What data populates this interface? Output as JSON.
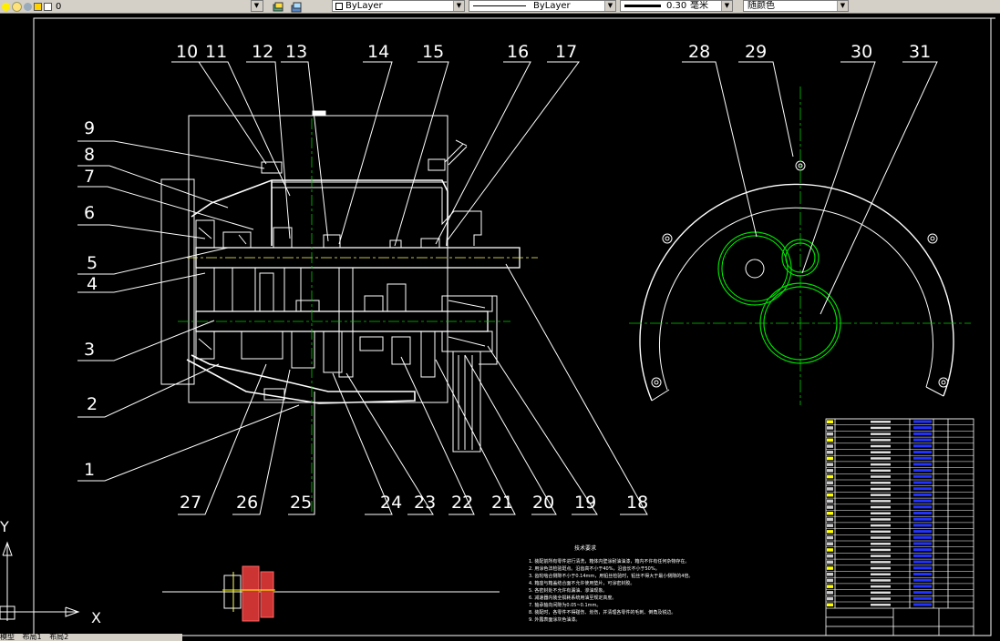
{
  "toolbar": {
    "layer_value": "0",
    "color_combo": "ByLayer",
    "linetype_combo": "ByLayer",
    "lineweight_value": "0.30",
    "lineweight_unit": "毫米",
    "plotstyle_combo": "随颜色"
  },
  "part_numbers": {
    "left": [
      "9",
      "8",
      "7",
      "6",
      "5",
      "4",
      "3",
      "2",
      "1"
    ],
    "top": [
      "10",
      "11",
      "12",
      "13",
      "14",
      "15",
      "16",
      "17"
    ],
    "bottom": [
      "27",
      "26",
      "25",
      "24",
      "23",
      "22",
      "21",
      "20",
      "19",
      "18"
    ],
    "gear_view": [
      "28",
      "29",
      "30",
      "31"
    ]
  },
  "ucs": {
    "x_label": "X",
    "y_label": "Y"
  },
  "tech_requirements": {
    "title": "技术要求",
    "lines": [
      "1. 装配前所有零件进行清洗，箱体内壁涂耐油油漆，箱内不许有任何杂物存在。",
      "2. 用涂色法检验斑点。沿齿高不小于40%，沿齿长不小于50%。",
      "3. 齿轮啮合侧隙不小于0.14mm，用铅丝检验时，铅丝不得大于最小侧隙的4倍。",
      "4. 箱座与箱盖结合面不允许使用垫片，可涂密封胶。",
      "5. 各密封处不允许有漏油、渗油现象。",
      "6. 减速器内装全损耗系统用油至规定高度。",
      "7. 轴承轴向间隙为0.05~0.1mm。",
      "8. 装配时，各零件不得碰伤、划伤，并清理各零件的毛刺、倒角及锐边。",
      "9. 外露表面涂灰色油漆。"
    ]
  },
  "statusbar": {
    "items": [
      "模型",
      "布局1",
      "布局2"
    ]
  },
  "colors": {
    "background": "#000000",
    "lines": "#ffffff",
    "centerline": "#00cc00",
    "hatch": "#cc3333",
    "table_blue": "#2233ff",
    "table_yellow": "#ffff00",
    "toolbar": "#d4d0c8"
  }
}
